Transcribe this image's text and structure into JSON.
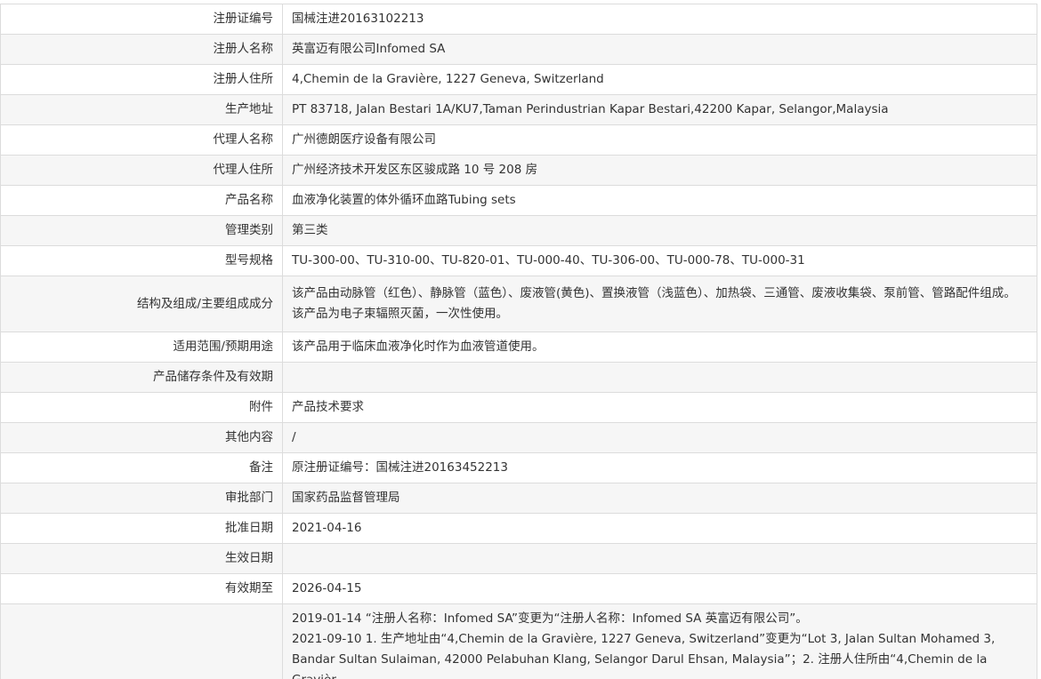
{
  "rows": [
    {
      "label": "注册证编号",
      "value": "国械注进20163102213"
    },
    {
      "label": "注册人名称",
      "value": "英富迈有限公司Infomed SA"
    },
    {
      "label": "注册人住所",
      "value": "4,Chemin de la Gravière, 1227 Geneva, Switzerland"
    },
    {
      "label": "生产地址",
      "value": "PT 83718, Jalan Bestari 1A/KU7,Taman Perindustrian Kapar Bestari,42200 Kapar, Selangor,Malaysia"
    },
    {
      "label": "代理人名称",
      "value": "广州德朗医疗设备有限公司"
    },
    {
      "label": "代理人住所",
      "value": "广州经济技术开发区东区骏成路 10 号 208 房"
    },
    {
      "label": "产品名称",
      "value": "血液净化装置的体外循环血路Tubing sets"
    },
    {
      "label": "管理类别",
      "value": "第三类"
    },
    {
      "label": "型号规格",
      "value": "TU-300-00、TU-310-00、TU-820-01、TU-000-40、TU-306-00、TU-000-78、TU-000-31"
    },
    {
      "label": "结构及组成/主要组成成分",
      "value": "该产品由动脉管（红色）、静脉管（蓝色）、废液管(黄色)、置换液管（浅蓝色）、加热袋、三通管、废液收集袋、泵前管、管路配件组成。该产品为电子束辐照灭菌，一次性使用。"
    },
    {
      "label": "适用范围/预期用途",
      "value": "该产品用于临床血液净化时作为血液管道使用。"
    },
    {
      "label": "产品储存条件及有效期",
      "value": ""
    },
    {
      "label": "附件",
      "value": "产品技术要求"
    },
    {
      "label": "其他内容",
      "value": "/"
    },
    {
      "label": "备注",
      "value": "原注册证编号：国械注进20163452213"
    },
    {
      "label": "审批部门",
      "value": "国家药品监督管理局"
    },
    {
      "label": "批准日期",
      "value": "2021-04-16"
    },
    {
      "label": "生效日期",
      "value": ""
    },
    {
      "label": "有效期至",
      "value": "2026-04-15"
    }
  ],
  "history": {
    "label": "",
    "entries": [
      "2019-01-14 “注册人名称：Infomed SA”变更为“注册人名称：Infomed SA 英富迈有限公司”。",
      "2021-09-10 1. 生产地址由“4,Chemin de la Gravière, 1227 Geneva, Switzerland”变更为“Lot 3, Jalan Sultan Mohamed 3, Bandar Sultan Sulaiman, 42000 Pelabuhan Klang, Selangor Darul Ehsan, Malaysia”；2. 注册人住所由“4,Chemin de la Gravièr"
    ]
  }
}
